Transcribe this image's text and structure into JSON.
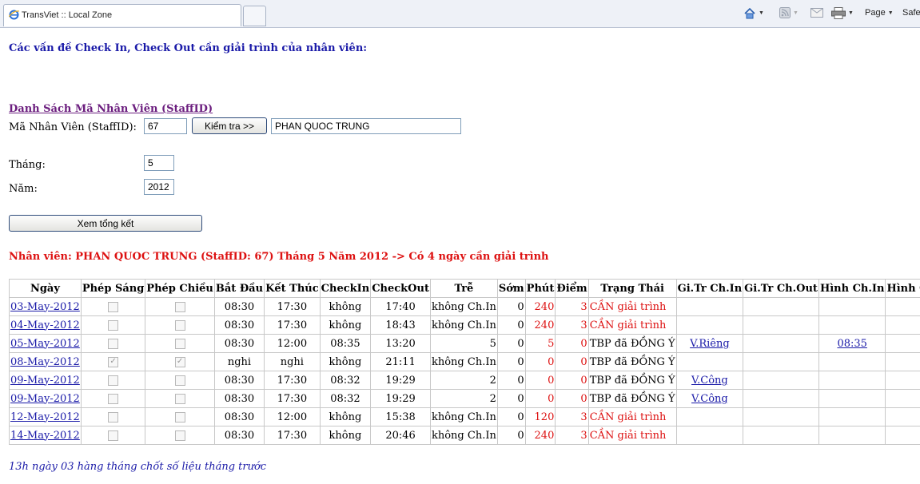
{
  "browser": {
    "tab_title": "TransViet :: Local Zone",
    "page_menu": "Page",
    "safety_menu": "Safe"
  },
  "page": {
    "heading": "Các vấn đề Check In, Check Out cần giải trình của nhân viên:",
    "staff_list_link": "Danh Sách Mã Nhân Viên (StaffID)",
    "staff_id_label": "Mã Nhân Viên (StaffID):",
    "staff_id_value": "67",
    "check_button": "Kiểm tra >>",
    "staff_name_value": "PHAN QUOC TRUNG",
    "month_label": "Tháng:",
    "month_value": "5",
    "year_label": "Năm:",
    "year_value": "2012",
    "summary_button": "Xem tổng kết",
    "result_text": "Nhân viên: PHAN QUOC TRUNG (StaffID: 67) Tháng 5 Năm 2012 -> Có 4 ngày cần giải trình",
    "footer": "13h ngày 03 hàng tháng chốt số liệu tháng trước"
  },
  "table": {
    "headers": [
      "Ngày",
      "Phép Sáng",
      "Phép Chiều",
      "Bắt Đầu",
      "Kết Thúc",
      "CheckIn",
      "CheckOut",
      "Trễ",
      "Sớm",
      "Phút",
      "Điểm",
      "Trạng Thái",
      "Gi.Tr Ch.In",
      "Gi.Tr Ch.Out",
      "Hình Ch.In",
      "Hình Ch.Out"
    ],
    "rows": [
      {
        "date": "03-May-2012",
        "am": false,
        "pm": false,
        "start": "08:30",
        "end": "17:30",
        "checkin": "không",
        "checkout": "17:40",
        "late": "không Ch.In",
        "early": "0",
        "minutes": "240",
        "points": "3",
        "status": "CẦN giải trình",
        "gtr_in": "",
        "gtr_out": "",
        "img_in": "",
        "img_out": ""
      },
      {
        "date": "04-May-2012",
        "am": false,
        "pm": false,
        "start": "08:30",
        "end": "17:30",
        "checkin": "không",
        "checkout": "18:43",
        "late": "không Ch.In",
        "early": "0",
        "minutes": "240",
        "points": "3",
        "status": "CẦN giải trình",
        "gtr_in": "",
        "gtr_out": "",
        "img_in": "",
        "img_out": ""
      },
      {
        "date": "05-May-2012",
        "am": false,
        "pm": false,
        "start": "08:30",
        "end": "12:00",
        "checkin": "08:35",
        "checkout": "13:20",
        "late": "5",
        "early": "0",
        "minutes": "5",
        "points": "0",
        "status": "TBP đã ĐỒNG Ý",
        "gtr_in": "V.Riêng",
        "gtr_out": "",
        "img_in": "08:35",
        "img_out": ""
      },
      {
        "date": "08-May-2012",
        "am": true,
        "pm": true,
        "start": "nghi",
        "end": "nghi",
        "checkin": "không",
        "checkout": "21:11",
        "late": "không Ch.In",
        "early": "0",
        "minutes": "0",
        "points": "0",
        "status": "TBP đã ĐỒNG Ý",
        "gtr_in": "",
        "gtr_out": "",
        "img_in": "",
        "img_out": ""
      },
      {
        "date": "09-May-2012",
        "am": false,
        "pm": false,
        "start": "08:30",
        "end": "17:30",
        "checkin": "08:32",
        "checkout": "19:29",
        "late": "2",
        "early": "0",
        "minutes": "0",
        "points": "0",
        "status": "TBP đã ĐỒNG Ý",
        "gtr_in": "V.Công",
        "gtr_out": "",
        "img_in": "",
        "img_out": ""
      },
      {
        "date": "09-May-2012",
        "am": false,
        "pm": false,
        "start": "08:30",
        "end": "17:30",
        "checkin": "08:32",
        "checkout": "19:29",
        "late": "2",
        "early": "0",
        "minutes": "0",
        "points": "0",
        "status": "TBP đã ĐỒNG Ý",
        "gtr_in": "V.Công",
        "gtr_out": "",
        "img_in": "",
        "img_out": ""
      },
      {
        "date": "12-May-2012",
        "am": false,
        "pm": false,
        "start": "08:30",
        "end": "12:00",
        "checkin": "không",
        "checkout": "15:38",
        "late": "không Ch.In",
        "early": "0",
        "minutes": "120",
        "points": "3",
        "status": "CẦN giải trình",
        "gtr_in": "",
        "gtr_out": "",
        "img_in": "",
        "img_out": ""
      },
      {
        "date": "14-May-2012",
        "am": false,
        "pm": false,
        "start": "08:30",
        "end": "17:30",
        "checkin": "không",
        "checkout": "20:46",
        "late": "không Ch.In",
        "early": "0",
        "minutes": "240",
        "points": "3",
        "status": "CẦN giải trình",
        "gtr_in": "",
        "gtr_out": "",
        "img_in": "",
        "img_out": ""
      }
    ]
  },
  "colors": {
    "heading": "#1a1aa8",
    "alert": "#dd1111",
    "link_visited": "#6b1d7e"
  }
}
